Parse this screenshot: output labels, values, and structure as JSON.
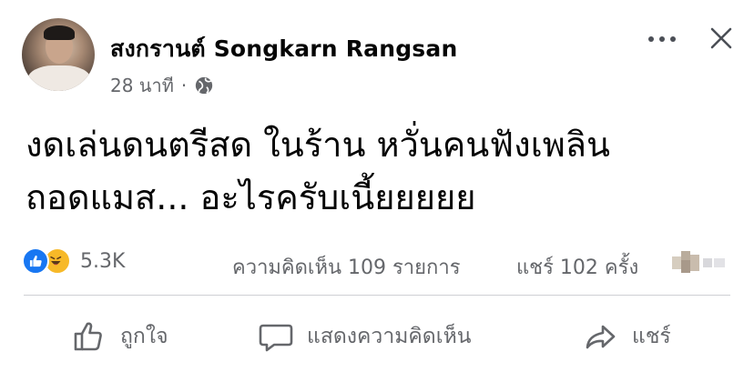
{
  "post": {
    "author": "สงกรานต์ Songkarn Rangsan",
    "time": "28 นาที",
    "separator": "·",
    "privacy_icon": "globe-icon",
    "text_lines": [
      "งดเล่นดนตรีสด ในร้าน หวั่นคนฟังเพลิน",
      "ถอดแมส... อะไรครับเนี้ยยยยย"
    ]
  },
  "stats": {
    "reaction_icons": [
      "like-reaction-icon",
      "haha-reaction-icon"
    ],
    "reaction_count": "5.3K",
    "comments": "ความคิดเห็น 109 รายการ",
    "shares": "แชร์ 102 ครั้ง"
  },
  "actions": {
    "like": "ถูกใจ",
    "comment": "แสดงความคิดเห็น",
    "share": "แชร์"
  },
  "colors": {
    "text": "#050505",
    "secondary": "#65676b",
    "like_blue": "#1877f2",
    "haha_yellow": "#f7b928",
    "divider": "#ced0d4"
  }
}
